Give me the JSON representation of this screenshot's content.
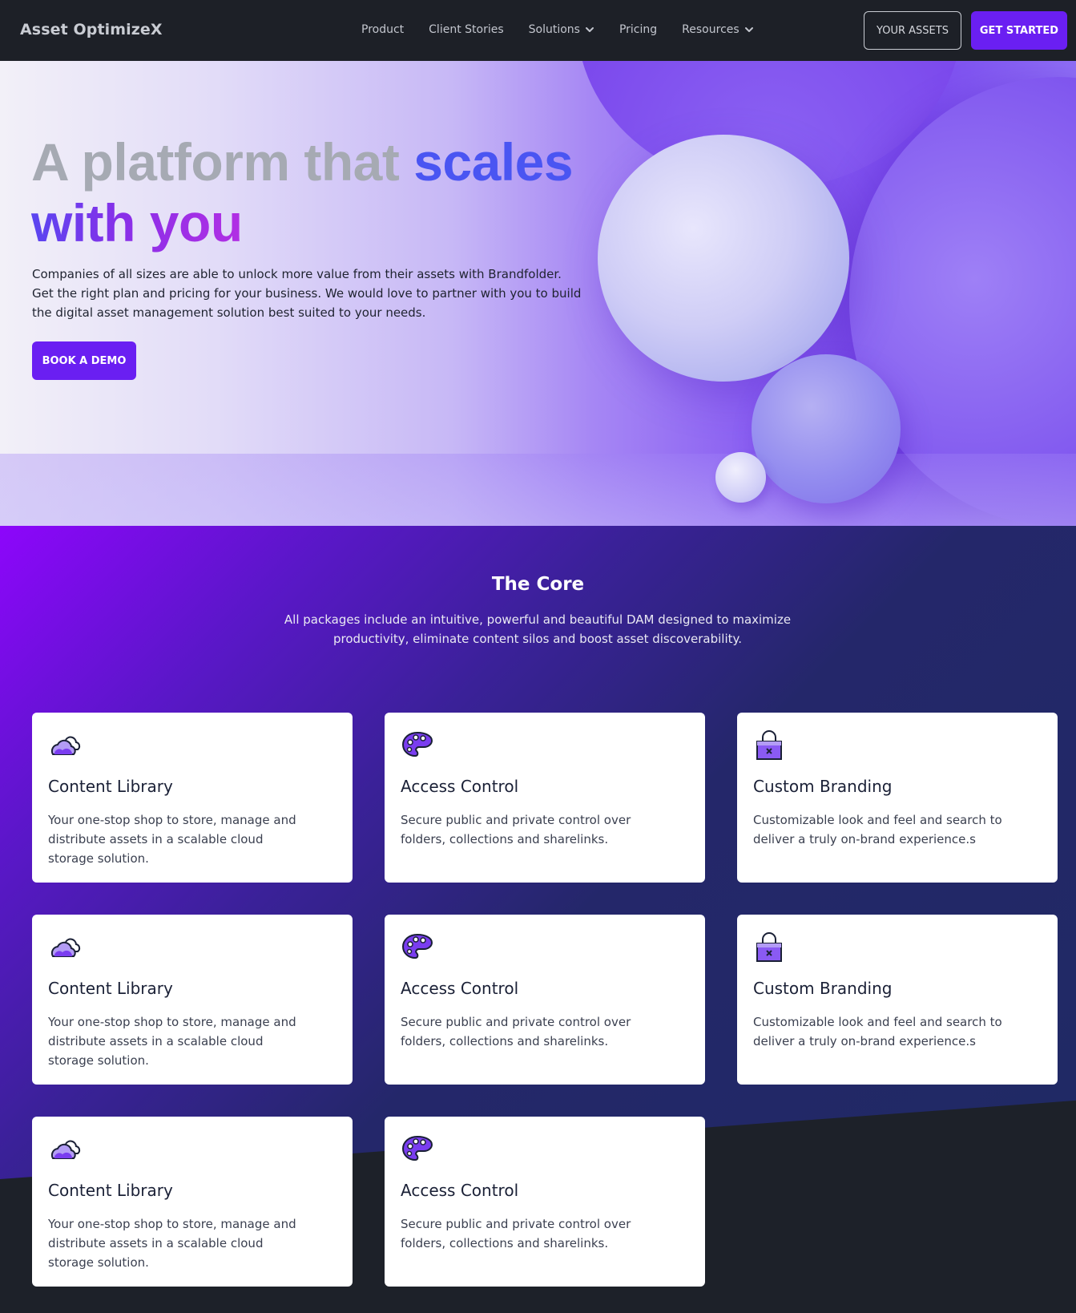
{
  "nav": {
    "brand": "Asset OptimizeX",
    "links": [
      "Product",
      "Client Stories",
      "Solutions",
      "Pricing",
      "Resources"
    ],
    "your_assets": "YOUR ASSETS",
    "get_started": "GET STARTED"
  },
  "hero": {
    "title_part1": "A platform that ",
    "title_part2": "scales",
    "title_part3": "with you",
    "description": "Companies of all sizes are able to unlock more value from their assets with Brandfolder. Get the right plan and pricing for your business. We would love to partner with you to build the digital asset management solution best suited to your needs.",
    "cta": "BOOK A DEMO"
  },
  "core": {
    "title": "The Core",
    "subtitle": "All packages include an intuitive, powerful and beautiful DAM designed to maximize productivity, eliminate content silos and boost asset discoverability.",
    "cards": [
      {
        "icon": "cloud-icon",
        "title": "Content Library",
        "text": "Your one-stop shop to store, manage and distribute assets in a scalable cloud storage solution."
      },
      {
        "icon": "palette-icon",
        "title": "Access Control",
        "text": "Secure public and private control over folders, collections and sharelinks."
      },
      {
        "icon": "lock-icon",
        "title": "Custom Branding",
        "text": "Customizable look and feel and search to deliver a truly on-brand experience.s"
      },
      {
        "icon": "cloud-icon",
        "title": "Content Library",
        "text": "Your one-stop shop to store, manage and distribute assets in a scalable cloud storage solution."
      },
      {
        "icon": "palette-icon",
        "title": "Access Control",
        "text": "Secure public and private control over folders, collections and sharelinks."
      },
      {
        "icon": "lock-icon",
        "title": "Custom Branding",
        "text": "Customizable look and feel and search to deliver a truly on-brand experience.s"
      },
      {
        "icon": "cloud-icon",
        "title": "Content Library",
        "text": "Your one-stop shop to store, manage and distribute assets in a scalable cloud storage solution."
      },
      {
        "icon": "palette-icon",
        "title": "Access Control",
        "text": "Secure public and private control over folders, collections and sharelinks."
      }
    ]
  },
  "colors": {
    "accent": "#6a1ff2",
    "nav_bg": "#1d2027",
    "title_blue": "#4a55f2",
    "title_gray": "#a6aab3"
  }
}
